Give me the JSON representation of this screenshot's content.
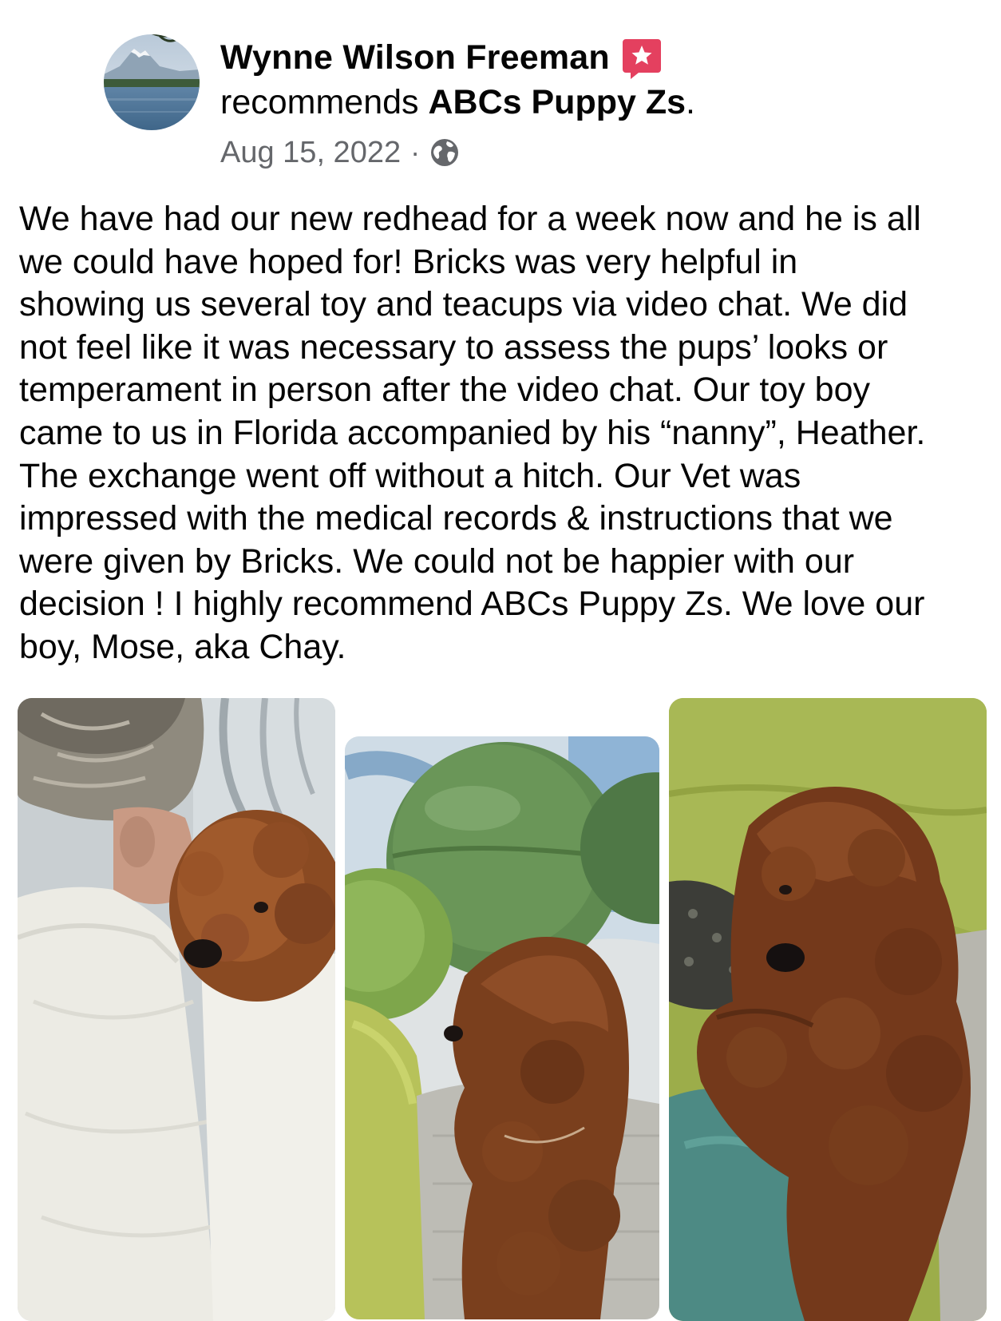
{
  "post": {
    "author": {
      "name": "Wynne Wilson Freeman",
      "avatar_icon": "mountain-lake-avatar"
    },
    "recommendation": {
      "verb": "recommends",
      "page_name": "ABCs Puppy Zs",
      "punctuation": ".",
      "badge_icon": "recommend-star-icon",
      "badge_color": "#e4405f"
    },
    "meta": {
      "date": "Aug 15, 2022",
      "separator": "·",
      "privacy_icon": "globe-icon"
    },
    "body_lines": [
      "We have had our new redhead for a week now and he is all",
      "we could have hoped for! Bricks was very helpful in",
      "showing us several toy and teacups via video chat. We did",
      "not feel like it was necessary to assess the pups’ looks or",
      "temperament in person after the video chat. Our toy boy",
      "came to us in Florida accompanied by his “nanny”, Heather.",
      "The exchange went off without a hitch. Our Vet was",
      "impressed with the medical records & instructions that we",
      "were given by Bricks. We could not be happier with our",
      "decision ! I highly recommend ABCs Puppy Zs. We love our",
      "boy, Mose, aka Chay."
    ],
    "photos": [
      {
        "icon": "puppy-hug-photo"
      },
      {
        "icon": "puppy-profile-photo"
      },
      {
        "icon": "puppy-couch-photo"
      }
    ],
    "colors": {
      "text_primary": "#050505",
      "text_secondary": "#65676b",
      "background": "#ffffff"
    }
  }
}
